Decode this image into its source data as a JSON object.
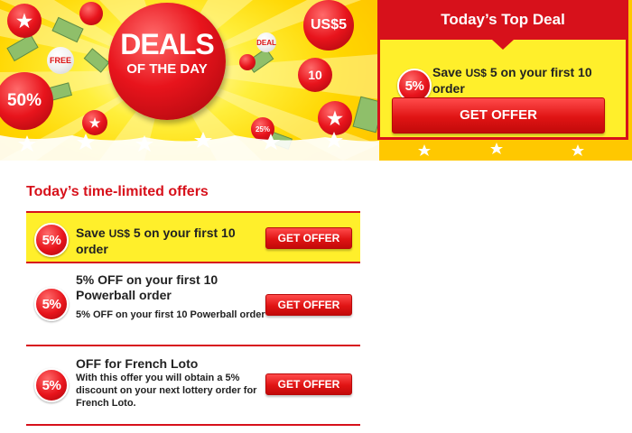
{
  "banner": {
    "headline_top": "DEALS",
    "headline_bottom": "OF THE DAY",
    "ball_labels": {
      "usd": "US$5",
      "free": "FREE",
      "fifty": "50%",
      "ten": "10",
      "twentyfive": "25%",
      "deal": "DEAL"
    }
  },
  "top_deal": {
    "heading": "Today’s Top Deal",
    "badge": "5%",
    "text_prefix": "Save ",
    "text_currency": "US$",
    "text_suffix": " 5 on your first 10 order",
    "button": "GET OFFER"
  },
  "offers_section": {
    "title": "Today’s time-limited offers",
    "offers": [
      {
        "badge": "5%",
        "title_prefix": "Save ",
        "title_currency": "US$",
        "title_suffix": " 5 on your first 10 order",
        "description": "",
        "button": "GET OFFER"
      },
      {
        "badge": "5%",
        "title": "5% OFF on your first 10 Powerball order",
        "description": "5% OFF on your first 10 Powerball order",
        "button": "GET OFFER"
      },
      {
        "badge": "5%",
        "title": "OFF for French Loto",
        "description": "With this offer you will obtain a 5% discount on your next lottery order for French Loto.",
        "button": "GET OFFER"
      }
    ]
  },
  "colors": {
    "brand_red": "#d7111b",
    "highlight_yellow": "#ffef2b",
    "banner_yellow": "#ffd600"
  }
}
